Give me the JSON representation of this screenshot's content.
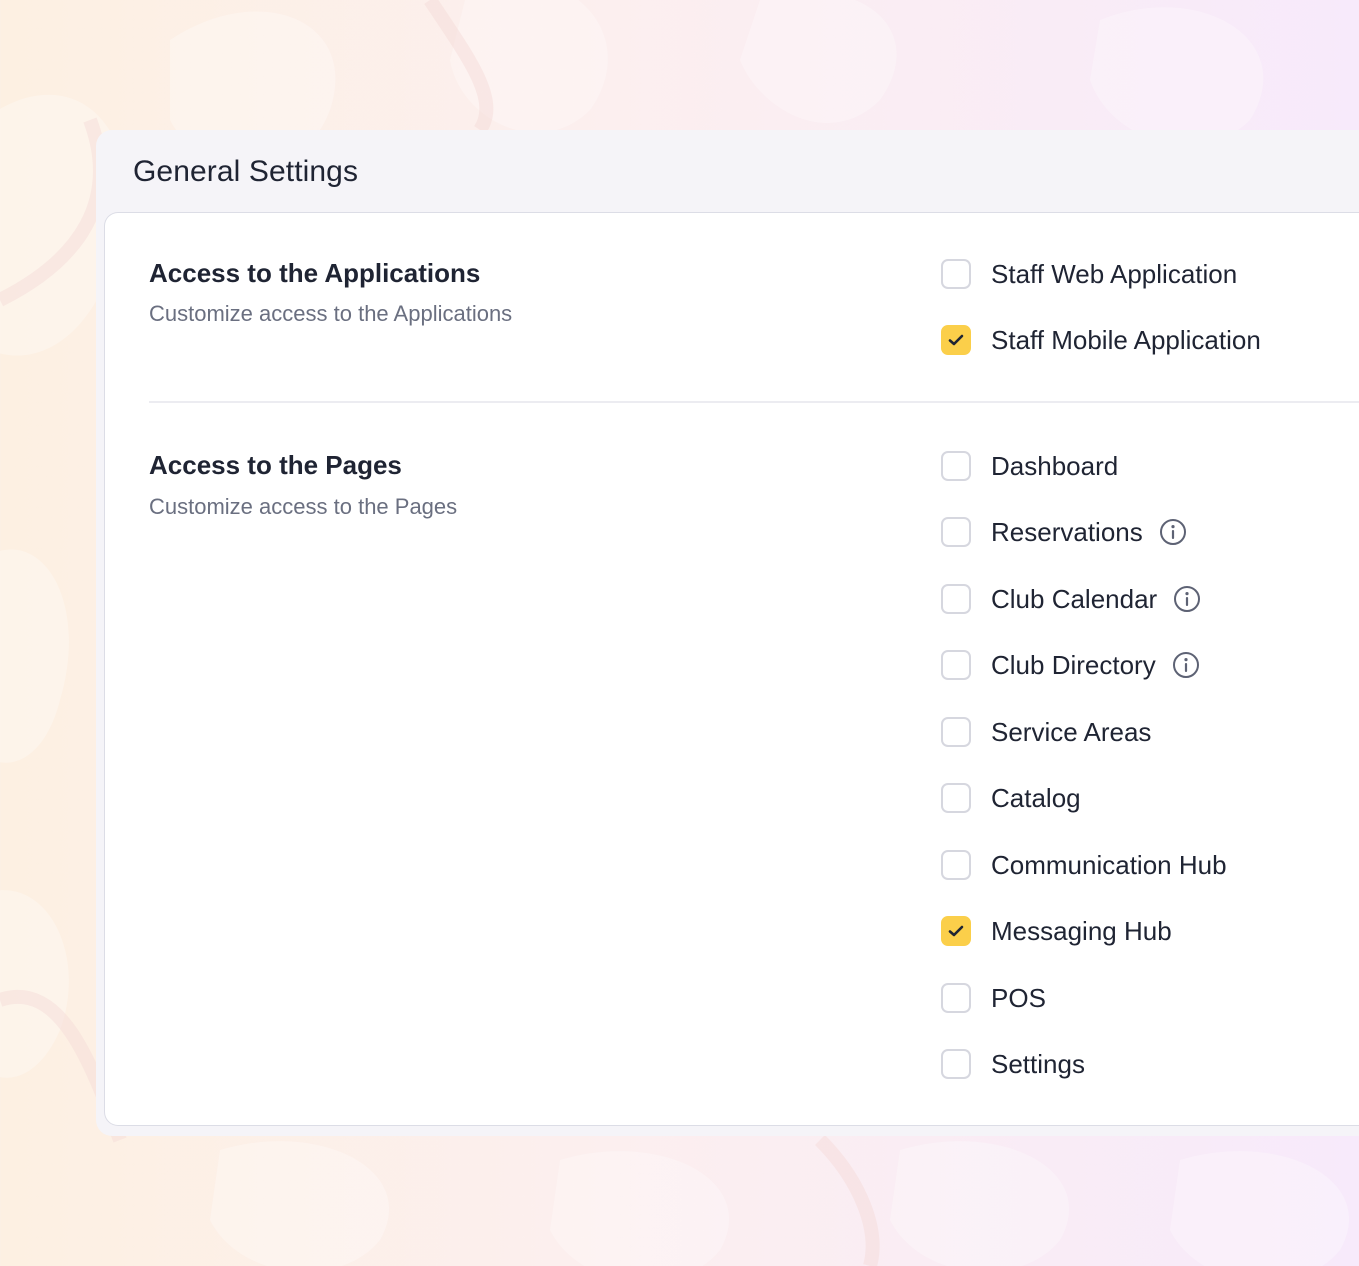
{
  "page": {
    "title": "General Settings"
  },
  "sections": [
    {
      "title": "Access to the Applications",
      "subtitle": "Customize access to the Applications",
      "options": [
        {
          "label": "Staff Web Application",
          "checked": false,
          "info": false
        },
        {
          "label": "Staff Mobile Application",
          "checked": true,
          "info": false
        }
      ]
    },
    {
      "title": "Access to the Pages",
      "subtitle": "Customize access to the Pages",
      "options": [
        {
          "label": "Dashboard",
          "checked": false,
          "info": false
        },
        {
          "label": "Reservations",
          "checked": false,
          "info": true
        },
        {
          "label": "Club Calendar",
          "checked": false,
          "info": true
        },
        {
          "label": "Club Directory",
          "checked": false,
          "info": true
        },
        {
          "label": "Service Areas",
          "checked": false,
          "info": false
        },
        {
          "label": "Catalog",
          "checked": false,
          "info": false
        },
        {
          "label": "Communication Hub",
          "checked": false,
          "info": false
        },
        {
          "label": "Messaging Hub",
          "checked": true,
          "info": false
        },
        {
          "label": "POS",
          "checked": false,
          "info": false
        },
        {
          "label": "Settings",
          "checked": false,
          "info": false
        }
      ]
    }
  ],
  "icons": {
    "check": "check-icon",
    "info": "info-icon"
  },
  "colors": {
    "accent": "#fbcf4a",
    "text": "#1f2433",
    "muted": "#6a6f80",
    "checkbox_border": "#d6d7df"
  }
}
